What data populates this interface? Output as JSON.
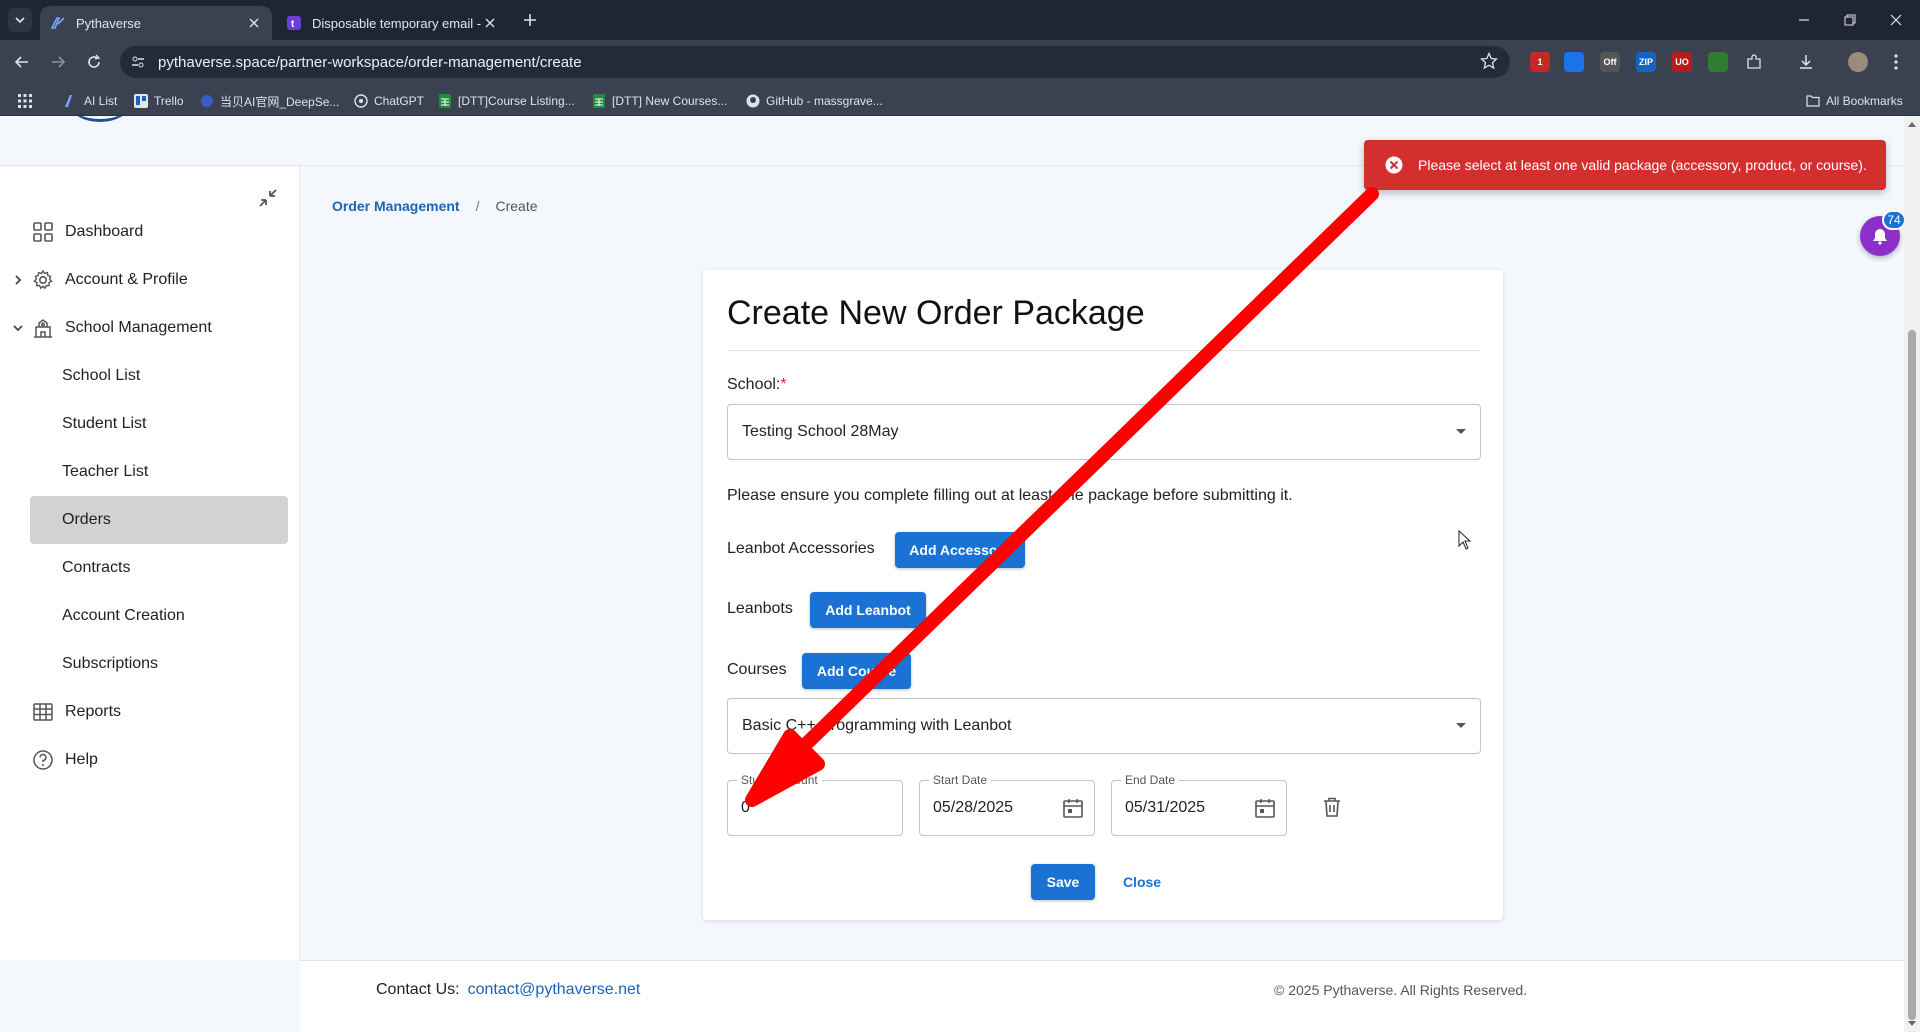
{
  "browser": {
    "tabs": [
      {
        "title": "Pythaverse",
        "active": true
      },
      {
        "title": "Disposable temporary email - T",
        "active": false
      }
    ],
    "url": "pythaverse.space/partner-workspace/order-management/create",
    "extensions": [
      {
        "name": "ext-red",
        "color": "#c62828",
        "badge": "1"
      },
      {
        "name": "ext-translate",
        "color": "#1a73e8",
        "badge": ""
      },
      {
        "name": "ext-off",
        "color": "#555555",
        "badge": "Off"
      },
      {
        "name": "ext-zip",
        "color": "#1565c0",
        "badge": "ZIP"
      },
      {
        "name": "ext-ublock",
        "color": "#b71c1c",
        "badge": "UO"
      },
      {
        "name": "ext-green",
        "color": "#2e7d32",
        "badge": ""
      }
    ],
    "bookmarks": [
      "AI List",
      "Trello",
      "当贝AI官网_DeepSe...",
      "ChatGPT",
      "[DTT]Course Listing...",
      "[DTT] New Courses...",
      "GitHub - massgrave..."
    ],
    "all_bookmarks": "All Bookmarks"
  },
  "sidebar": {
    "items": [
      {
        "label": "Dashboard",
        "icon": "grid-icon"
      },
      {
        "label": "Account & Profile",
        "icon": "gear-icon",
        "expandable": true,
        "expanded": false
      },
      {
        "label": "School Management",
        "icon": "school-icon",
        "expandable": true,
        "expanded": true
      }
    ],
    "sub_items": [
      {
        "label": "School List"
      },
      {
        "label": "Student List"
      },
      {
        "label": "Teacher List"
      },
      {
        "label": "Orders",
        "active": true
      },
      {
        "label": "Contracts"
      },
      {
        "label": "Account Creation"
      },
      {
        "label": "Subscriptions"
      }
    ],
    "bottom_items": [
      {
        "label": "Reports",
        "icon": "table-icon"
      },
      {
        "label": "Help",
        "icon": "help-icon"
      }
    ]
  },
  "breadcrumb": {
    "parent": "Order Management",
    "separator": "/",
    "current": "Create"
  },
  "form": {
    "title": "Create New Order Package",
    "school_label": "School:",
    "school_required": "*",
    "school_value": "Testing School 28May",
    "notice": "Please ensure you complete filling out at least one package before submitting it.",
    "accessories_label": "Leanbot Accessories",
    "add_accessory": "Add Accessory",
    "leanbots_label": "Leanbots",
    "add_leanbot": "Add Leanbot",
    "courses_label": "Courses",
    "add_course": "Add Course",
    "course_value": "Basic C++ Programming with Leanbot",
    "student_count_label": "Student Count",
    "student_count_value": "0",
    "start_date_label": "Start Date",
    "start_date_value": "05/28/2025",
    "end_date_label": "End Date",
    "end_date_value": "05/31/2025",
    "save": "Save",
    "close": "Close"
  },
  "toast": {
    "message": "Please select at least one valid package (accessory, product, or course).",
    "color": "#d32f2f"
  },
  "notifications": {
    "count": "74",
    "color": "#8a2fc8"
  },
  "footer": {
    "contact_label": "Contact Us:",
    "contact_email": "contact@pythaverse.net",
    "copyright": "© 2025 Pythaverse. All Rights Reserved."
  },
  "annotation": {
    "arrow_color": "#ff0000"
  }
}
